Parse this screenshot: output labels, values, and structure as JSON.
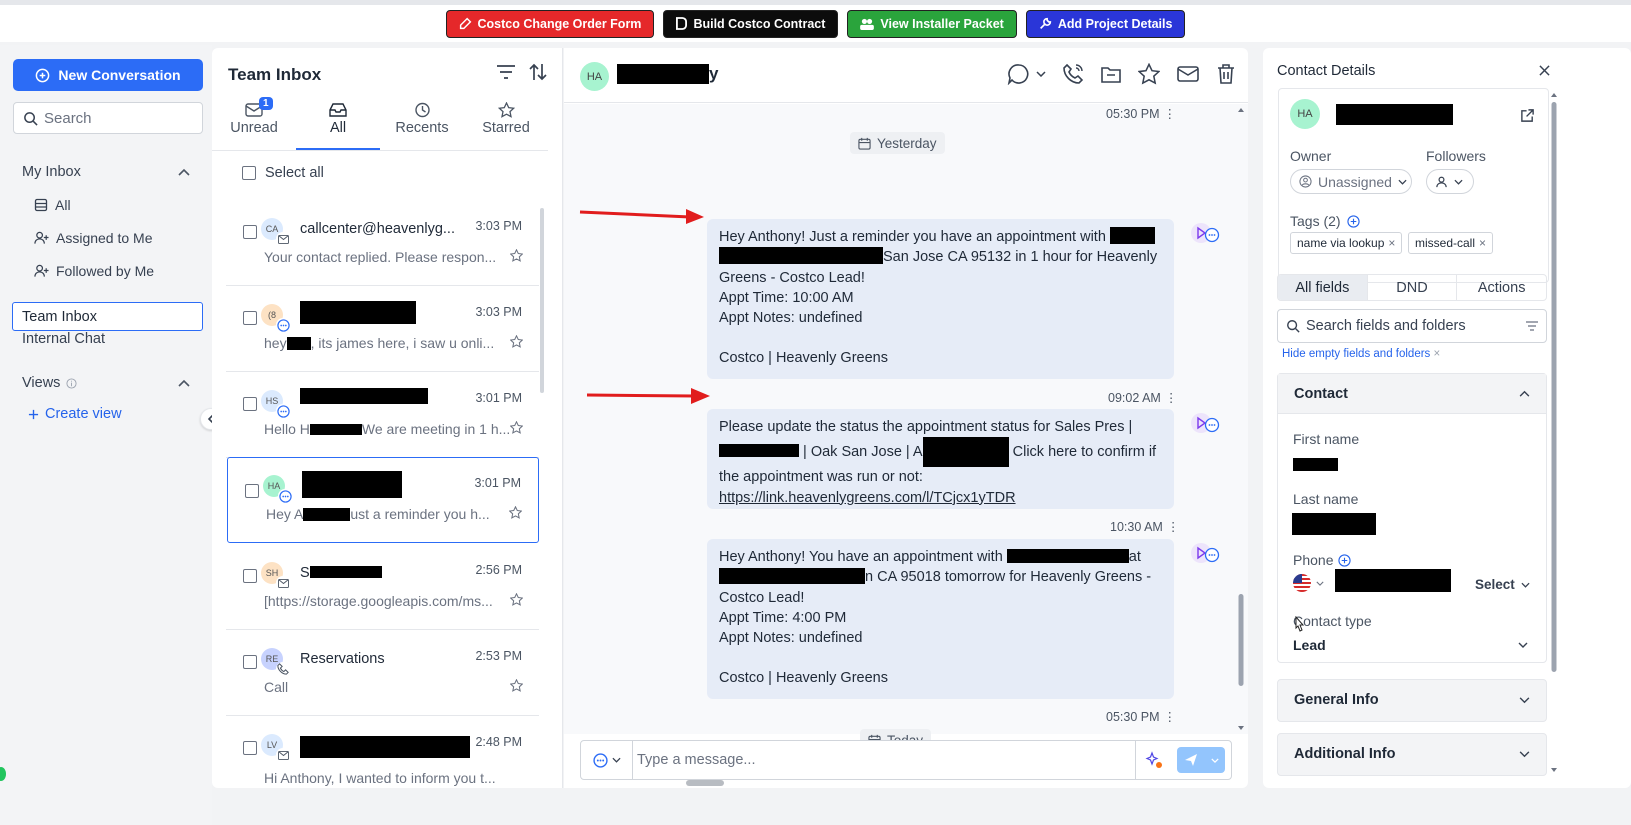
{
  "topbar": {
    "buttons": [
      {
        "label": "Costco Change Order Form",
        "color": "#e5282a",
        "icon": "edit-icon"
      },
      {
        "label": "Build Costco Contract",
        "color": "#0c0c0c",
        "icon": "document-icon"
      },
      {
        "label": "View Installer Packet",
        "color": "#2aa43c",
        "icon": "people-icon"
      },
      {
        "label": "Add Project Details",
        "color": "#2a36d8",
        "icon": "wrench-icon"
      }
    ]
  },
  "sidebar": {
    "new_conversation": "New Conversation",
    "search_placeholder": "Search",
    "my_inbox": "My Inbox",
    "items": [
      "All",
      "Assigned to Me",
      "Followed by Me"
    ],
    "team_inbox": "Team Inbox",
    "internal_chat": "Internal Chat",
    "views": "Views",
    "create_view": "Create view"
  },
  "list": {
    "title": "Team Inbox",
    "tabs": [
      {
        "label": "Unread",
        "badge": "1"
      },
      {
        "label": "All"
      },
      {
        "label": "Recents"
      },
      {
        "label": "Starred"
      }
    ],
    "select_all": "Select all",
    "conversations": [
      {
        "initials": "CA",
        "name": "callcenter@heavenlyg...",
        "time": "3:03 PM",
        "preview": "Your contact replied. Please respon...",
        "color": "#dbeafe",
        "channel": "email-icon"
      },
      {
        "initials": "(8",
        "name": "",
        "time": "3:03 PM",
        "preview_a": "hey",
        "preview_b": ", its james here, i saw u onli...",
        "color": "#fde2c4",
        "channel": "chat-icon"
      },
      {
        "initials": "HS",
        "name": "",
        "time": "3:01 PM",
        "preview_a": "Hello H",
        "preview_b": "We are meeting in 1 h...",
        "color": "#dbeafe",
        "channel": "chat-icon"
      },
      {
        "initials": "HA",
        "name": "",
        "time": "3:01 PM",
        "preview_a": "Hey A",
        "preview_b": "ust a reminder you h...",
        "color": "#a7f3d0",
        "channel": "chat-icon"
      },
      {
        "initials": "SH",
        "name": "S",
        "time": "2:56 PM",
        "preview": "[https://storage.googleapis.com/ms...",
        "color": "#fde2c4",
        "channel": "email-icon"
      },
      {
        "initials": "RE",
        "name": "Reservations",
        "time": "2:53 PM",
        "preview": "Call",
        "color": "#c7d2fe",
        "channel": "phone-icon"
      },
      {
        "initials": "LV",
        "name": "",
        "time": "2:48 PM",
        "preview": "Hi Anthony, I wanted to inform you t...",
        "color": "#dbeafe",
        "channel": "email-icon"
      }
    ]
  },
  "chat": {
    "header_initials": "HA",
    "header_name_suffix": "y",
    "top_time": "05:30 PM",
    "day1": "Yesterday",
    "day2": "Today",
    "messages": [
      {
        "line1_a": "Hey Anthony! Just a reminder you have an appointment with",
        "line2_b": "San Jose CA 95132 in 1 hour for Heavenly",
        "line3": "Greens - Costco Lead!",
        "line4": "Appt Time: 10:00 AM",
        "line5": "Appt Notes: undefined",
        "line6": "Costco | Heavenly Greens",
        "time": "09:02 AM"
      },
      {
        "line1": "Please update the status the appointment status for Sales Pres |",
        "line2_a": "| Oak San Jose | A",
        "line2_b": "Click here to confirm if",
        "line3": "the appointment was run or not:",
        "link": "https://link.heavenlygreens.com/l/TCjcx1yTDR",
        "time": "10:30 AM"
      },
      {
        "line1_a": "Hey Anthony! You have an appointment with",
        "line1_b": "at",
        "line2_b": "n CA 95018 tomorrow for Heavenly Greens -",
        "line3": "Costco Lead!",
        "line4": "Appt Time: 4:00 PM",
        "line5": "Appt Notes: undefined",
        "line6": "Costco | Heavenly Greens",
        "time": "05:30 PM"
      }
    ],
    "composer_placeholder": "Type a message..."
  },
  "contact": {
    "title": "Contact Details",
    "initials": "HA",
    "owner_label": "Owner",
    "owner_value": "Unassigned",
    "followers_label": "Followers",
    "tags_label": "Tags (2)",
    "tags": [
      "name via lookup",
      "missed-call"
    ],
    "tabs": [
      "All fields",
      "DND",
      "Actions"
    ],
    "search_placeholder": "Search fields and folders",
    "hide_empty": "Hide empty fields and folders",
    "section_contact": "Contact",
    "first_name_label": "First name",
    "last_name_label": "Last name",
    "phone_label": "Phone",
    "phone_select": "Select",
    "contact_type_label": "Contact type",
    "contact_type_value": "Lead",
    "section_general": "General Info",
    "section_additional": "Additional Info"
  },
  "colors": {
    "accent": "#2c6cf6",
    "bubble": "#e6ecf7",
    "arrow": "#e11d1d"
  }
}
